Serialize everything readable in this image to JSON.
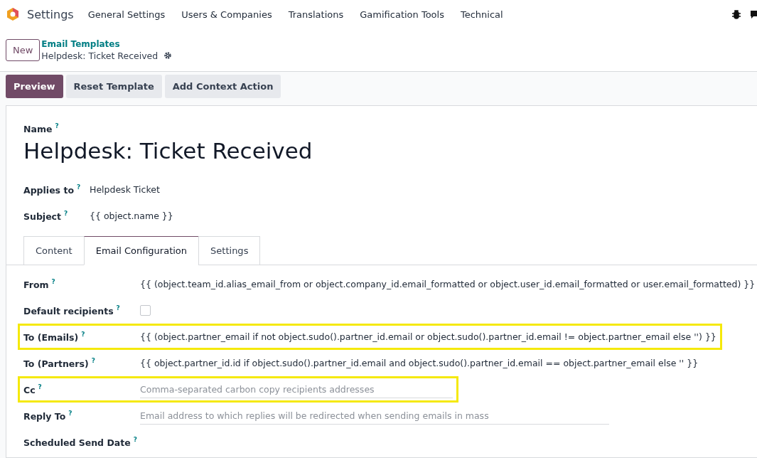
{
  "navbar": {
    "app": "Settings",
    "menu": [
      "General Settings",
      "Users & Companies",
      "Translations",
      "Gamification Tools",
      "Technical"
    ]
  },
  "breadcrumb": {
    "new_button": "New",
    "parent": "Email Templates",
    "current": "Helpdesk: Ticket Received"
  },
  "actions": [
    {
      "label": "Preview",
      "primary": true
    },
    {
      "label": "Reset Template",
      "primary": false
    },
    {
      "label": "Add Context Action",
      "primary": false
    }
  ],
  "form": {
    "name_label": "Name",
    "help": "?",
    "name": "Helpdesk: Ticket Received",
    "fields": [
      {
        "label": "Applies to",
        "value": "Helpdesk Ticket"
      },
      {
        "label": "Subject",
        "value": "{{ object.name }}"
      }
    ],
    "tabs": [
      {
        "label": "Content",
        "selected": false
      },
      {
        "label": "Email Configuration",
        "selected": true
      },
      {
        "label": "Settings",
        "selected": false
      }
    ],
    "rows": [
      {
        "kind": "text",
        "label": "From",
        "value": "{{ (object.team_id.alias_email_from or object.company_id.email_formatted or object.user_id.email_formatted or user.email_formatted) }}",
        "highlighted": false
      },
      {
        "kind": "checkbox",
        "label": "Default recipients",
        "checked": false,
        "highlighted": false
      },
      {
        "kind": "text",
        "label": "To (Emails)",
        "value": "{{ (object.partner_email if not object.sudo().partner_id.email or object.sudo().partner_id.email != object.partner_email else '') }}",
        "highlighted": true
      },
      {
        "kind": "text",
        "label": "To (Partners)",
        "value": "{{ object.partner_id.id if object.sudo().partner_id.email and object.sudo().partner_id.email == object.partner_email else '' }}",
        "highlighted": false
      },
      {
        "kind": "input",
        "label": "Cc",
        "placeholder": "Comma-separated carbon copy recipients addresses",
        "highlighted": true
      },
      {
        "kind": "input",
        "label": "Reply To",
        "placeholder": "Email address to which replies will be redirected when sending emails in mass",
        "highlighted": false
      },
      {
        "kind": "empty",
        "label": "Scheduled Send Date",
        "highlighted": false
      }
    ]
  }
}
